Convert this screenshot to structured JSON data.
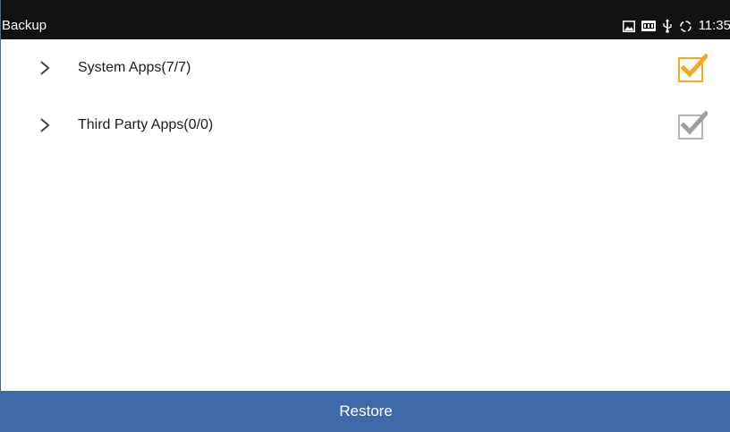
{
  "status_bar": {
    "title": "Backup",
    "time": "11:35",
    "icons": [
      "image-icon",
      "ftp-icon",
      "usb-icon",
      "sync-icon"
    ]
  },
  "list": {
    "items": [
      {
        "label": "System Apps(7/7)",
        "checked": true,
        "checkbox_color": "#f7a823"
      },
      {
        "label": "Third Party Apps(0/0)",
        "checked": true,
        "checkbox_color": "#9e9e9e"
      }
    ]
  },
  "footer": {
    "restore_label": "Restore"
  },
  "colors": {
    "status_bar_bg": "#121212",
    "accent_blue": "#3f6aa8",
    "check_orange": "#f7a823",
    "check_gray": "#9e9e9e"
  }
}
